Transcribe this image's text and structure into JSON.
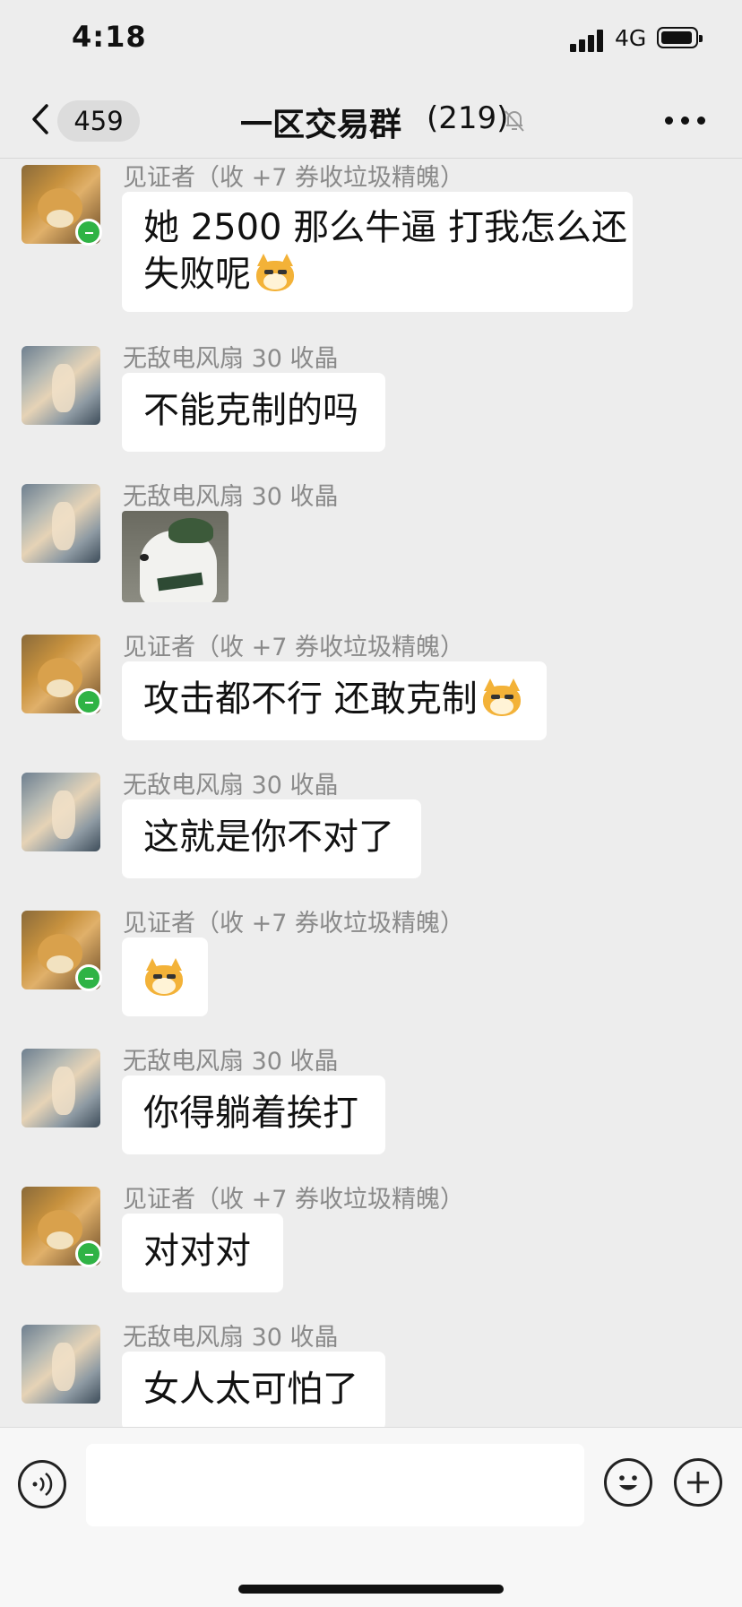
{
  "status_bar": {
    "time": "4:18",
    "network": "4G"
  },
  "nav": {
    "back_badge": "459",
    "title": "一区交易群",
    "member_count": "(219)",
    "icons": {
      "back": "chevron-left-icon",
      "mute": "bell-slash-icon",
      "more": "ellipsis-icon"
    }
  },
  "messages": [
    {
      "sender": "见证者（收 +7 券收垃圾精魄）",
      "avatar": "dog",
      "text": "她 2500 那么牛逼 打我怎么还",
      "text2": "失败呢"
    },
    {
      "sender": "无敌电风扇 30 收晶",
      "avatar": "art",
      "text": "不能克制的吗"
    },
    {
      "sender": "无敌电风扇 30 收晶",
      "avatar": "art",
      "sticker": "dog-in-hat-sticker"
    },
    {
      "sender": "见证者（收 +7 券收垃圾精魄）",
      "avatar": "dog",
      "text": "攻击都不行 还敢克制"
    },
    {
      "sender": "无敌电风扇 30 收晶",
      "avatar": "art",
      "text": "这就是你不对了"
    },
    {
      "sender": "见证者（收 +7 券收垃圾精魄）",
      "avatar": "dog",
      "emoji_only": "doge-emoji"
    },
    {
      "sender": "无敌电风扇 30 收晶",
      "avatar": "art",
      "text": "你得躺着挨打"
    },
    {
      "sender": "见证者（收 +7 券收垃圾精魄）",
      "avatar": "dog",
      "text": "对对对"
    },
    {
      "sender": "无敌电风扇 30 收晶",
      "avatar": "art",
      "text": "女人太可怕了"
    }
  ],
  "input_bar": {
    "value": "",
    "icons": {
      "voice": "voice-icon",
      "emoji": "smiley-icon",
      "plus": "plus-icon"
    }
  }
}
